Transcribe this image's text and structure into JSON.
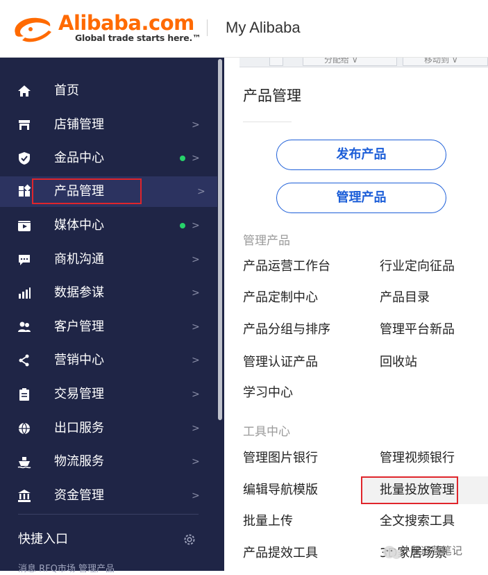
{
  "header": {
    "logo_word": "Alibaba.com",
    "logo_tagline": "Global trade starts here.™",
    "title": "My Alibaba"
  },
  "sidebar": {
    "items": [
      {
        "label": "首页",
        "icon": "home-icon",
        "arrow": "",
        "dot": false,
        "active": false
      },
      {
        "label": "店铺管理",
        "icon": "store-icon",
        "arrow": ">",
        "dot": false,
        "active": false
      },
      {
        "label": "金品中心",
        "icon": "shield-icon",
        "arrow": ">",
        "dot": true,
        "active": false
      },
      {
        "label": "产品管理",
        "icon": "product-grid-icon",
        "arrow": ">",
        "dot": false,
        "active": true
      },
      {
        "label": "媒体中心",
        "icon": "media-icon",
        "arrow": ">",
        "dot": true,
        "active": false
      },
      {
        "label": "商机沟通",
        "icon": "chat-icon",
        "arrow": ">",
        "dot": false,
        "active": false
      },
      {
        "label": "数据参谋",
        "icon": "bar-chart-icon",
        "arrow": ">",
        "dot": false,
        "active": false
      },
      {
        "label": "客户管理",
        "icon": "customers-icon",
        "arrow": ">",
        "dot": false,
        "active": false
      },
      {
        "label": "营销中心",
        "icon": "share-icon",
        "arrow": ">",
        "dot": false,
        "active": false
      },
      {
        "label": "交易管理",
        "icon": "clipboard-icon",
        "arrow": ">",
        "dot": false,
        "active": false
      },
      {
        "label": "出口服务",
        "icon": "globe-icon",
        "arrow": ">",
        "dot": false,
        "active": false
      },
      {
        "label": "物流服务",
        "icon": "ship-icon",
        "arrow": ">",
        "dot": false,
        "active": false
      },
      {
        "label": "资金管理",
        "icon": "bank-icon",
        "arrow": ">",
        "dot": false,
        "active": false
      }
    ],
    "quick_entry": "快捷入口",
    "bottom_text": "消息   RFQ市场   管理产品"
  },
  "background_tabs": [
    "分配给 ∨",
    "移动到 ∨"
  ],
  "panel": {
    "title": "产品管理",
    "primary_buttons": [
      "发布产品",
      "管理产品"
    ],
    "sections": [
      {
        "title": "管理产品",
        "links": [
          [
            "产品运营工作台",
            "行业定向征品"
          ],
          [
            "产品定制中心",
            "产品目录"
          ],
          [
            "产品分组与排序",
            "管理平台新品"
          ],
          [
            "管理认证产品",
            "回收站"
          ],
          [
            "学习中心",
            ""
          ]
        ]
      },
      {
        "title": "工具中心",
        "links": [
          [
            "管理图片银行",
            "管理视频银行"
          ],
          [
            "编辑导航模版",
            "批量投放管理"
          ],
          [
            "批量上传",
            "全文搜索工具"
          ],
          [
            "产品提效工具",
            "3D家居场景"
          ]
        ]
      }
    ]
  },
  "watermark": "外贸运营笔记",
  "colors": {
    "sidebar_bg": "#1f2546",
    "accent_orange": "#ff6a00",
    "link_blue": "#1c5ed8",
    "highlight_red": "#e0252b",
    "status_green": "#27d36a"
  }
}
